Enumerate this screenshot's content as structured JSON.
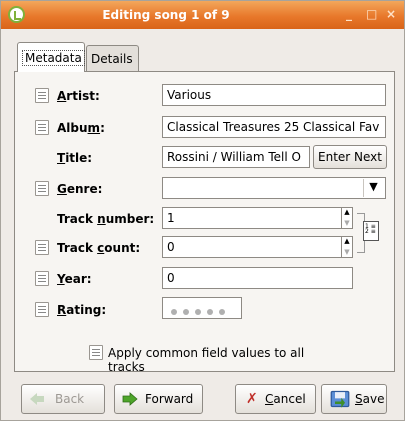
{
  "window": {
    "title": "Editing song 1 of 9",
    "minimize_glyph": "_",
    "maximize_glyph": "□",
    "close_glyph": "×"
  },
  "tabs": [
    {
      "label": "Metadata",
      "active": true
    },
    {
      "label": "Details",
      "active": false
    }
  ],
  "fields": {
    "artist": {
      "label_pre": "",
      "label_mnemonic": "A",
      "label_post": "rtist:",
      "value": "Various"
    },
    "album": {
      "label_pre": "Albu",
      "label_mnemonic": "m",
      "label_post": ":",
      "value": "Classical Treasures 25 Classical Fav"
    },
    "title": {
      "label_pre": "",
      "label_mnemonic": "T",
      "label_post": "itle:",
      "value": "Rossini / William Tell O"
    },
    "genre": {
      "label_pre": "",
      "label_mnemonic": "G",
      "label_post": "enre:",
      "value": ""
    },
    "track_number": {
      "label_pre": "Track ",
      "label_mnemonic": "n",
      "label_post": "umber:",
      "value": "1"
    },
    "track_count": {
      "label_pre": "Track ",
      "label_mnemonic": "c",
      "label_post": "ount:",
      "value": "0"
    },
    "year": {
      "label_pre": "",
      "label_mnemonic": "Y",
      "label_post": "ear:",
      "value": "0"
    },
    "rating": {
      "label_pre": "",
      "label_mnemonic": "R",
      "label_post": "ating:",
      "stars": 0
    }
  },
  "buttons": {
    "enter_next": "Enter Next",
    "apply_common": "Apply common field values to all tracks",
    "back": "Back",
    "forward": "Forward",
    "cancel_mnemonic": "C",
    "cancel_rest": "ancel",
    "save_mnemonic": "S",
    "save_rest": "ave"
  },
  "colors": {
    "titlebar": "#e8782b",
    "window_bg": "#efebe7",
    "forward_arrow": "#4ea52a",
    "cancel_x": "#c0302a"
  },
  "icons": {
    "app": "app-icon",
    "field": "field-copy-icon",
    "track_link": "track-link-icon"
  }
}
